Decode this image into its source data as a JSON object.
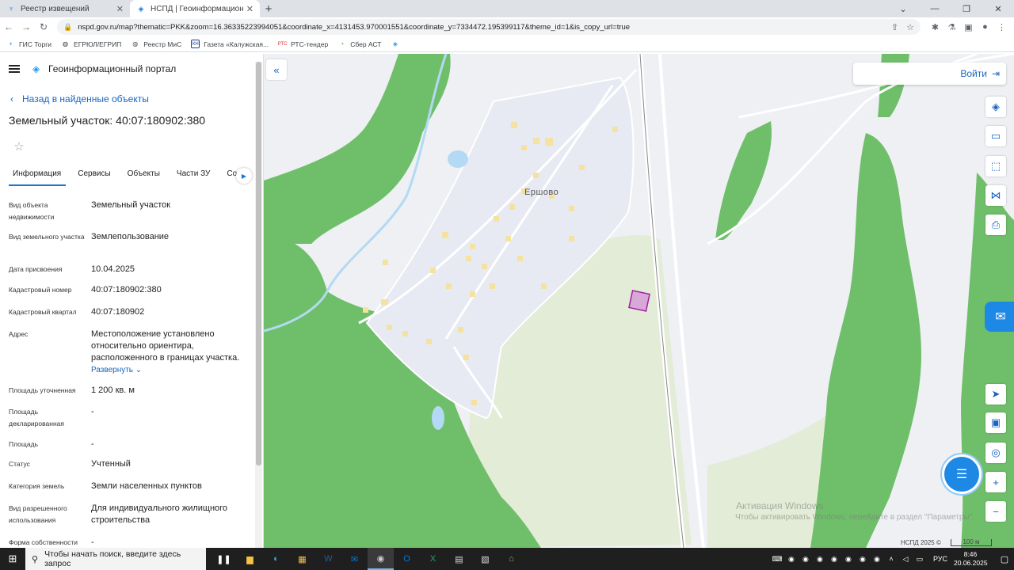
{
  "browser": {
    "tabs": [
      {
        "title": "Реестр извещений",
        "close": "✕"
      },
      {
        "title": "НСПД | Геоинформационный п",
        "close": "✕"
      }
    ],
    "new_tab": "+",
    "url": "nspd.gov.ru/map?thematic=PKK&zoom=16.36335223994051&coordinate_x=4131453.970001551&coordinate_y=7334472.195399117&theme_id=1&is_copy_url=true",
    "bookmarks": [
      "ГИС Торги",
      "ЕГРЮЛ/ЕГРИП",
      "Реестр МиС",
      "Газета «Калужская...",
      "РТС-тендер",
      "Сбер АСТ"
    ]
  },
  "panel": {
    "portal_title": "Геоинформационный портал",
    "back_label": "Назад в найденные объекты",
    "object_title": "Земельный участок: 40:07:180902:380",
    "tabs": [
      "Информация",
      "Сервисы",
      "Объекты",
      "Части ЗУ",
      "Соста"
    ],
    "attributes": [
      {
        "label": "Вид объекта недвижимости",
        "value": "Земельный участок"
      },
      {
        "label": "Вид земельного участка",
        "value": "Землепользование"
      },
      {
        "label": "Дата присвоения",
        "value": "10.04.2025"
      },
      {
        "label": "Кадастровый номер",
        "value": "40:07:180902:380"
      },
      {
        "label": "Кадастровый квартал",
        "value": "40:07:180902"
      },
      {
        "label": "Адрес",
        "value": "Местоположение установлено относительно ориентира, расположенного в границах участка."
      },
      {
        "label": "Площадь уточненная",
        "value": "1 200 кв. м"
      },
      {
        "label": "Площадь декларированная",
        "value": "-"
      },
      {
        "label": "Площадь",
        "value": "-"
      },
      {
        "label": "Статус",
        "value": "Учтенный"
      },
      {
        "label": "Категория земель",
        "value": "Земли населенных пунктов"
      },
      {
        "label": "Вид разрешенного использования",
        "value": "Для индивидуального жилищного строительства"
      },
      {
        "label": "Форма собственности",
        "value": "-"
      }
    ],
    "expand_label": "Развернуть"
  },
  "map": {
    "login_label": "Войти",
    "village_label": "Ершово",
    "watermark_title": "Активация Windows",
    "watermark_text": "Чтобы активировать Windows, перейдите в раздел \"Параметры\".",
    "copyright": "НСПД 2025 ©",
    "scale": "100 м",
    "colors": {
      "forest": "#6fbf6a",
      "field": "#e3ecd6",
      "settlement": "#e8eaf3",
      "parcel": "#d9a7d8",
      "parcel_border": "#a020a0",
      "water": "#b3d9f5"
    }
  },
  "taskbar": {
    "search_placeholder": "Чтобы начать поиск, введите здесь запрос",
    "language": "РУС",
    "time": "8:46",
    "date": "20.06.2025"
  }
}
